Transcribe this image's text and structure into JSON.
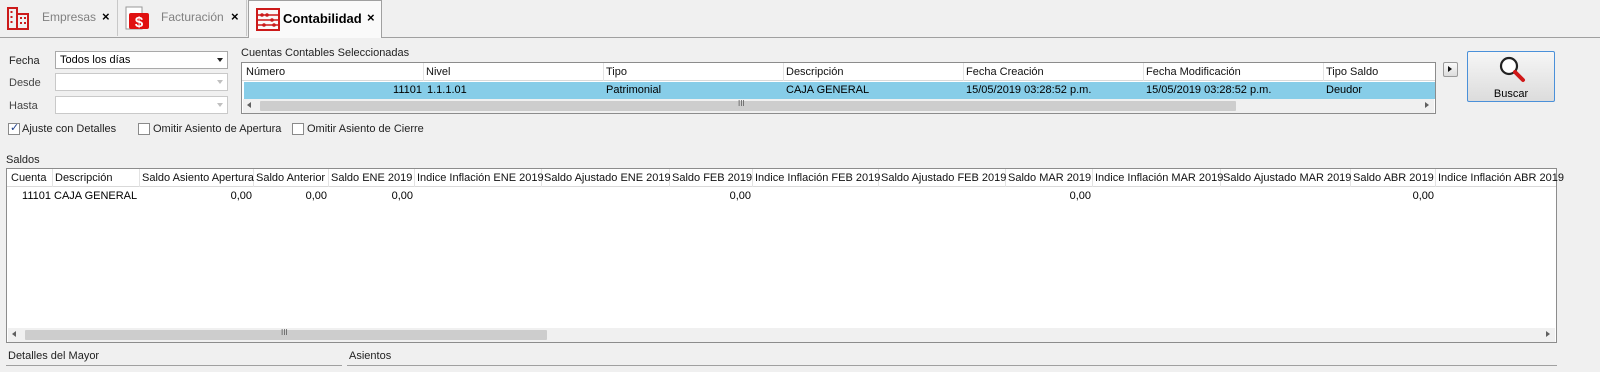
{
  "tabs": [
    {
      "label": "Empresas",
      "icon": "building-icon",
      "active": false
    },
    {
      "label": "Facturación",
      "icon": "dollar-icon",
      "active": false
    },
    {
      "label": "Contabilidad",
      "icon": "abacus-icon",
      "active": true
    }
  ],
  "close_glyph": "×",
  "filters": {
    "fecha_label": "Fecha",
    "fecha_value": "Todos los días",
    "desde_label": "Desde",
    "desde_value": "",
    "hasta_label": "Hasta",
    "hasta_value": ""
  },
  "cuentas": {
    "title": "Cuentas Contables Seleccionadas",
    "columns": [
      "Número",
      "Nivel",
      "Tipo",
      "Descripción",
      "Fecha Creación",
      "Fecha Modificación",
      "Tipo Saldo"
    ],
    "row": {
      "numero": "11101",
      "nivel": "1.1.1.01",
      "tipo": "Patrimonial",
      "descripcion": "CAJA GENERAL",
      "fecha_creacion": "15/05/2019 03:28:52 p.m.",
      "fecha_modificacion": "15/05/2019 03:28:52 p.m.",
      "tipo_saldo": "Deudor"
    },
    "row_highlight_color": "#87cde8"
  },
  "buscar": {
    "label": "Buscar",
    "icon": "magnifier-icon"
  },
  "options": [
    {
      "label": "Ajuste con Detalles",
      "checked": true
    },
    {
      "label": "Omitir Asiento de Apertura",
      "checked": false
    },
    {
      "label": "Omitir Asiento de Cierre",
      "checked": false
    }
  ],
  "saldos": {
    "title": "Saldos",
    "columns": [
      "Cuenta",
      "Descripción",
      "Saldo Asiento Apertura",
      "Saldo Anterior",
      "Saldo ENE 2019",
      "Indice Inflación ENE 2019",
      "Saldo Ajustado ENE 2019",
      "Saldo FEB 2019",
      "Indice Inflación FEB 2019",
      "Saldo Ajustado FEB 2019",
      "Saldo MAR 2019",
      "Indice Inflación MAR 2019",
      "Saldo Ajustado MAR 2019",
      "Saldo ABR 2019",
      "Indice Inflación ABR 2019"
    ],
    "row": {
      "cuenta": "11101",
      "descripcion": "CAJA GENERAL",
      "saldo_apertura": "0,00",
      "saldo_anterior": "0,00",
      "saldo_ene": "0,00",
      "saldo_feb": "0,00",
      "saldo_mar": "0,00",
      "saldo_abr": "0,00"
    }
  },
  "footer": {
    "detalles_label": "Detalles del Mayor",
    "asientos_label": "Asientos"
  },
  "scroll_glyph": "III"
}
